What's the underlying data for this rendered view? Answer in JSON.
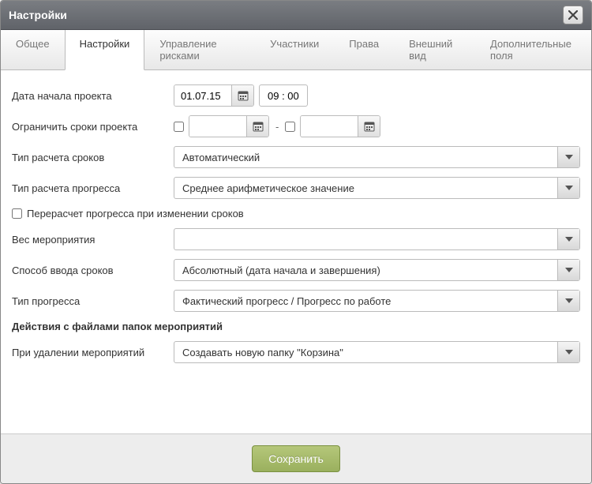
{
  "title": "Настройки",
  "tabs": [
    {
      "label": "Общее"
    },
    {
      "label": "Настройки"
    },
    {
      "label": "Управление рисками"
    },
    {
      "label": "Участники"
    },
    {
      "label": "Права"
    },
    {
      "label": "Внешний вид"
    },
    {
      "label": "Дополнительные поля"
    }
  ],
  "form": {
    "startDateLabel": "Дата начала проекта",
    "startDateValue": "01.07.15",
    "startTimeValue": "09 : 00",
    "limitDatesLabel": "Ограничить сроки проекта",
    "limitFrom": "",
    "limitTo": "",
    "calcTypeLabel": "Тип расчета сроков",
    "calcTypeValue": "Автоматический",
    "progressCalcLabel": "Тип расчета прогресса",
    "progressCalcValue": "Среднее арифметическое значение",
    "recalcCheckboxLabel": "Перерасчет прогресса при изменении сроков",
    "weightLabel": "Вес мероприятия",
    "weightValue": "",
    "inputMethodLabel": "Способ ввода сроков",
    "inputMethodValue": "Абсолютный (дата начала и завершения)",
    "progressTypeLabel": "Тип прогресса",
    "progressTypeValue": "Фактический прогресс / Прогресс по работе",
    "sectionHeader": "Действия с файлами папок мероприятий",
    "onDeleteLabel": "При удалении мероприятий",
    "onDeleteValue": "Создавать новую папку \"Корзина\""
  },
  "footer": {
    "saveLabel": "Сохранить"
  }
}
